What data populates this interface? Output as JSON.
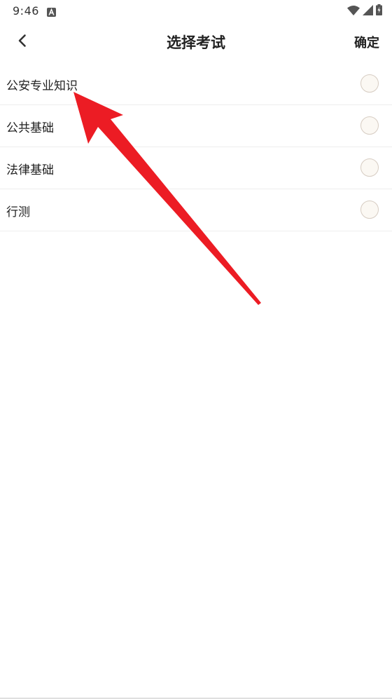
{
  "status_bar": {
    "time": "9:46",
    "icons": [
      "app-notification-icon",
      "wifi-icon",
      "cellular-signal-icon",
      "battery-charging-icon"
    ]
  },
  "header": {
    "back_icon": "chevron-left-icon",
    "title": "选择考试",
    "confirm_label": "确定"
  },
  "exams": [
    {
      "label": "公安专业知识",
      "selected": false
    },
    {
      "label": "公共基础",
      "selected": false
    },
    {
      "label": "法律基础",
      "selected": false
    },
    {
      "label": "行测",
      "selected": false
    }
  ],
  "annotation": {
    "type": "arrow",
    "color": "#ec1c24",
    "points_to": "exam-item-0"
  }
}
